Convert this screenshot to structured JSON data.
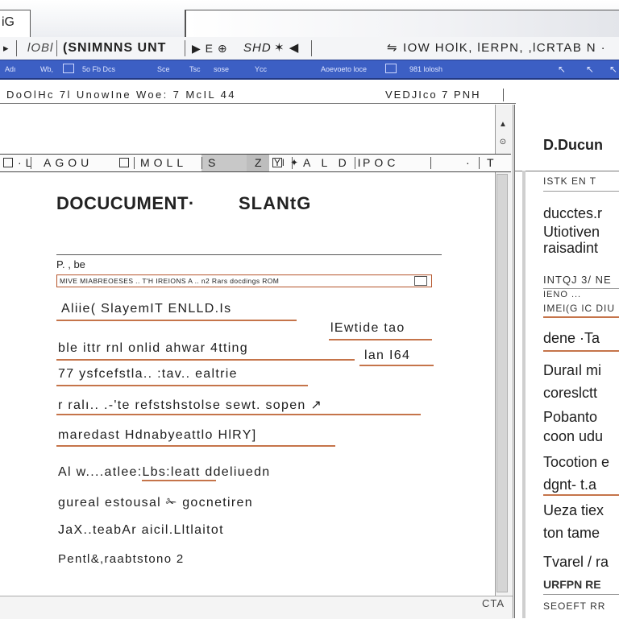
{
  "window": {
    "app_tab": "iG"
  },
  "command_bar": {
    "left_icon": "▸",
    "doc_label": "lOBl",
    "doc_name": "(SNIMNNS UNT",
    "nav_icons": "▶ E ⊕",
    "snippet": "SНD",
    "snippet_icons": "✶ ◀",
    "right_icon": "⇋",
    "right_text": "IOW HOlK, lERPN, ,lCRTAB  N ·"
  },
  "ribbon": {
    "items": [
      "Adı",
      "Wb,",
      "5o  Fb  Dcs",
      "Sce",
      "Tsc",
      "sose",
      "Ycc",
      "Aoevoeto  loce",
      "981  lolosh"
    ],
    "icons": [
      "ribbon-doc-icon",
      "ribbon-doc-icon",
      "ribbon-list-icon",
      "ribbon-cursor-icon",
      "ribbon-cursor-icon",
      "ribbon-cursor-icon"
    ]
  },
  "path_bar": {
    "left": "DoOlHc  7l  UnowIne  Woe: 7  McIL  44",
    "right": "VEDJIco 7  PNH"
  },
  "doc_toolbar": {
    "seg1": "·L",
    "seg2": "AGOU",
    "seg3": "MOLL",
    "seg4": "S",
    "seg5": "Z",
    "seg6": "Yl ✦",
    "seg7": "A L D I",
    "seg8": "POC",
    "seg9": "·",
    "seg10": "T",
    "scroll_up": "▲",
    "scroll_mid": "⊙"
  },
  "document": {
    "title": "DOCUCUMENT·",
    "title_2": "SLANtG",
    "para_label": "P.  ,  be",
    "field_strip": "MIVE  MIABREOESES  ..   T'H  IREIONS          A   ..  n2  Rars  docdings  ROM",
    "lines": [
      "Aliie(  SlayemIT ENLLD.Is",
      "lEwtide tao",
      "ble  ittr  rnl  onlid  ahwar  4tting",
      "lan  I64",
      "77  ysfcefstla..  :tav..  ealtrie",
      "r  ralı..  .-'te  refstshstolse  sewt.  sopen  ↗",
      "maredast  Hdnabyeattlo  HlRY]",
      "Al w....atlee:Lbs:leatt  ddeliuedn",
      "gureal  estousal  ✁  gocnetiren",
      "JaX..teabAr  aicil.Lltlaitot",
      "Pentl&,raabtstono  2"
    ]
  },
  "right_panel": {
    "title": "D.Ducun",
    "subtitle": "ISTK  EN  T",
    "blocks": [
      "ducctes.r",
      "Utiotiven",
      "raisadint",
      "INTQJ  3/  NE",
      "IENO  ...",
      "IMEl(G  lC  DIU",
      "dene  ·Ta",
      "Duraıl  mi",
      "coreslctt",
      "Pobanto",
      "coon  udu",
      "Tocotion e",
      "dgnt- t.a",
      "Ueza  tiex",
      "ton  tame",
      "Tvarel  / ra",
      "URFPN  RE",
      "SEOEFT  RR"
    ]
  },
  "status_bar": {
    "text": "CTA"
  },
  "colors": {
    "ribbon_blue": "#3c5fc4",
    "underline_orange": "#c5744a"
  }
}
